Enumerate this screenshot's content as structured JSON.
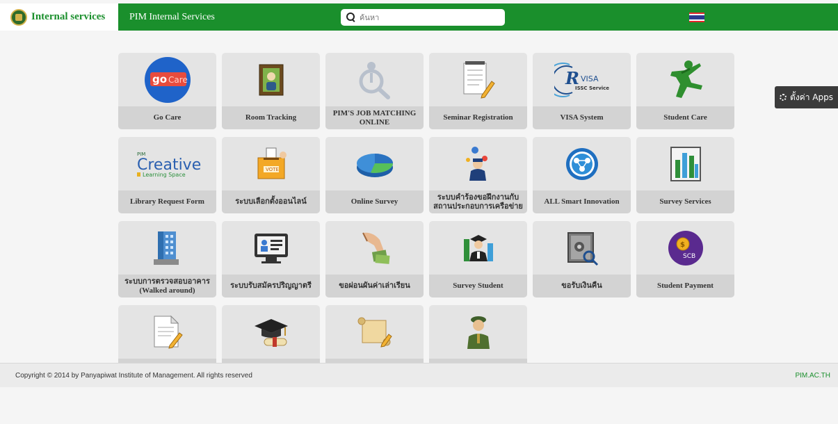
{
  "header": {
    "brand": "Internal services",
    "app_title": "PIM Internal Services",
    "search": {
      "placeholder": "ค้นหา",
      "value": ""
    },
    "language_flag": "thai-flag-icon"
  },
  "settings_button": {
    "label": "ตั้งค่า Apps",
    "icon": "gear-icon"
  },
  "tiles": [
    {
      "label": "Go Care",
      "icon": "gocare-icon"
    },
    {
      "label": "Room Tracking",
      "icon": "picture-frame-icon"
    },
    {
      "label": "PIM'S JOB MATCHING ONLINE",
      "icon": "job-search-icon"
    },
    {
      "label": "Seminar Registration",
      "icon": "notepad-pen-icon"
    },
    {
      "label": "VISA System",
      "icon": "visa-icon"
    },
    {
      "label": "Student Care",
      "icon": "running-person-icon"
    },
    {
      "label": "Library Request Form",
      "icon": "creative-learning-icon"
    },
    {
      "label": "ระบบเลือกตั้งออนไลน์",
      "icon": "vote-box-icon"
    },
    {
      "label": "Online Survey",
      "icon": "pie-chart-icon"
    },
    {
      "label": "ระบบคำร้องขอฝึกงานกับสถานประกอบการเครือข่าย",
      "icon": "worker-location-icon"
    },
    {
      "label": "ALL Smart Innovation",
      "icon": "network-people-icon"
    },
    {
      "label": "Survey Services",
      "icon": "bar-chart-icon"
    },
    {
      "label": "ระบบการตรวจสอบอาคาร (Walked around)",
      "icon": "building-icon"
    },
    {
      "label": "ระบบรับสมัครปริญญาตรี",
      "icon": "monitor-profile-icon"
    },
    {
      "label": "ขอผ่อนผันค่าเล่าเรียน",
      "icon": "handshake-money-icon"
    },
    {
      "label": "Survey Student",
      "icon": "graduate-chart-icon"
    },
    {
      "label": "ขอรับเงินคืน",
      "icon": "safe-icon"
    },
    {
      "label": "Student Payment",
      "icon": "scb-coin-icon"
    },
    {
      "label": "",
      "icon": "document-pen-icon"
    },
    {
      "label": "",
      "icon": "graduation-cap-icon"
    },
    {
      "label": "",
      "icon": "scroll-icon"
    },
    {
      "label": "",
      "icon": "soldier-icon"
    }
  ],
  "footer": {
    "copyright": "Copyright © 2014 by Panyapiwat Institute of Management. All rights reserved",
    "link": "PIM.AC.TH"
  },
  "colors": {
    "brand_green": "#1a8f2c",
    "tile_bg": "#e4e4e4",
    "tile_label_bg": "#d3d3d3"
  }
}
